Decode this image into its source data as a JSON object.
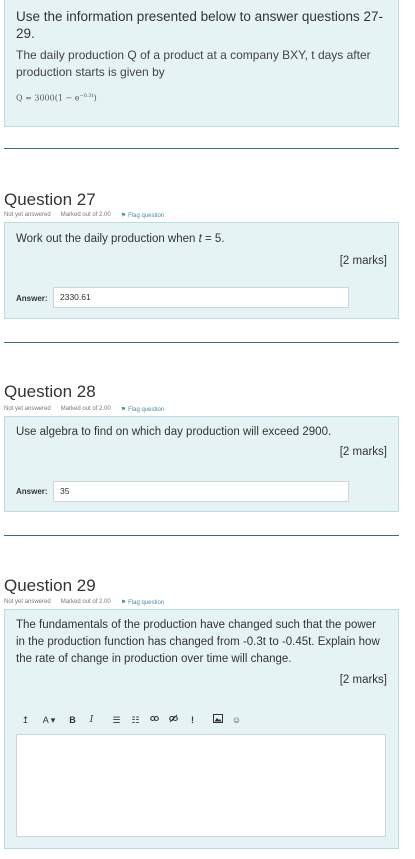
{
  "info": {
    "title": "Use the information presented below to answer questions 27-29.",
    "text": "The daily production Q of a product at a company BXY, t days after production starts is given by",
    "formula_main": "Q = 3000(1 − e",
    "formula_exp": "−0.3t",
    "formula_end": ")"
  },
  "questions": [
    {
      "title": "Question 27",
      "status": "Not yet answered",
      "marked": "Marked out of 2.00",
      "flag": "Flag question",
      "text": "Work out the daily production when t = 5.",
      "marks": "[2 marks]",
      "answer_label": "Answer:",
      "answer_value": "2330.61"
    },
    {
      "title": "Question 28",
      "status": "Not yet answered",
      "marked": "Marked out of 2.00",
      "flag": "Flag question",
      "text": "Use algebra to find on which day production will exceed 2900.",
      "marks": "[2 marks]",
      "answer_label": "Answer:",
      "answer_value": "35"
    },
    {
      "title": "Question 29",
      "status": "Not yet answered",
      "marked": "Marked out of 2.00",
      "flag": "Flag question",
      "text": "The fundamentals of the production have changed such that the power in the production function has changed from -0.3t to -0.45t. Explain how the rate of change in production over time will change.",
      "marks": "[2 marks]"
    }
  ],
  "toolbar": {
    "undo": "↥",
    "font": "A ▾",
    "bold": "B",
    "italic": "I",
    "ul": "☰",
    "ol": "☷",
    "link": "🔗",
    "unlink": "⛓",
    "emoji": "!",
    "image": "▣",
    "smiley": "☺"
  }
}
